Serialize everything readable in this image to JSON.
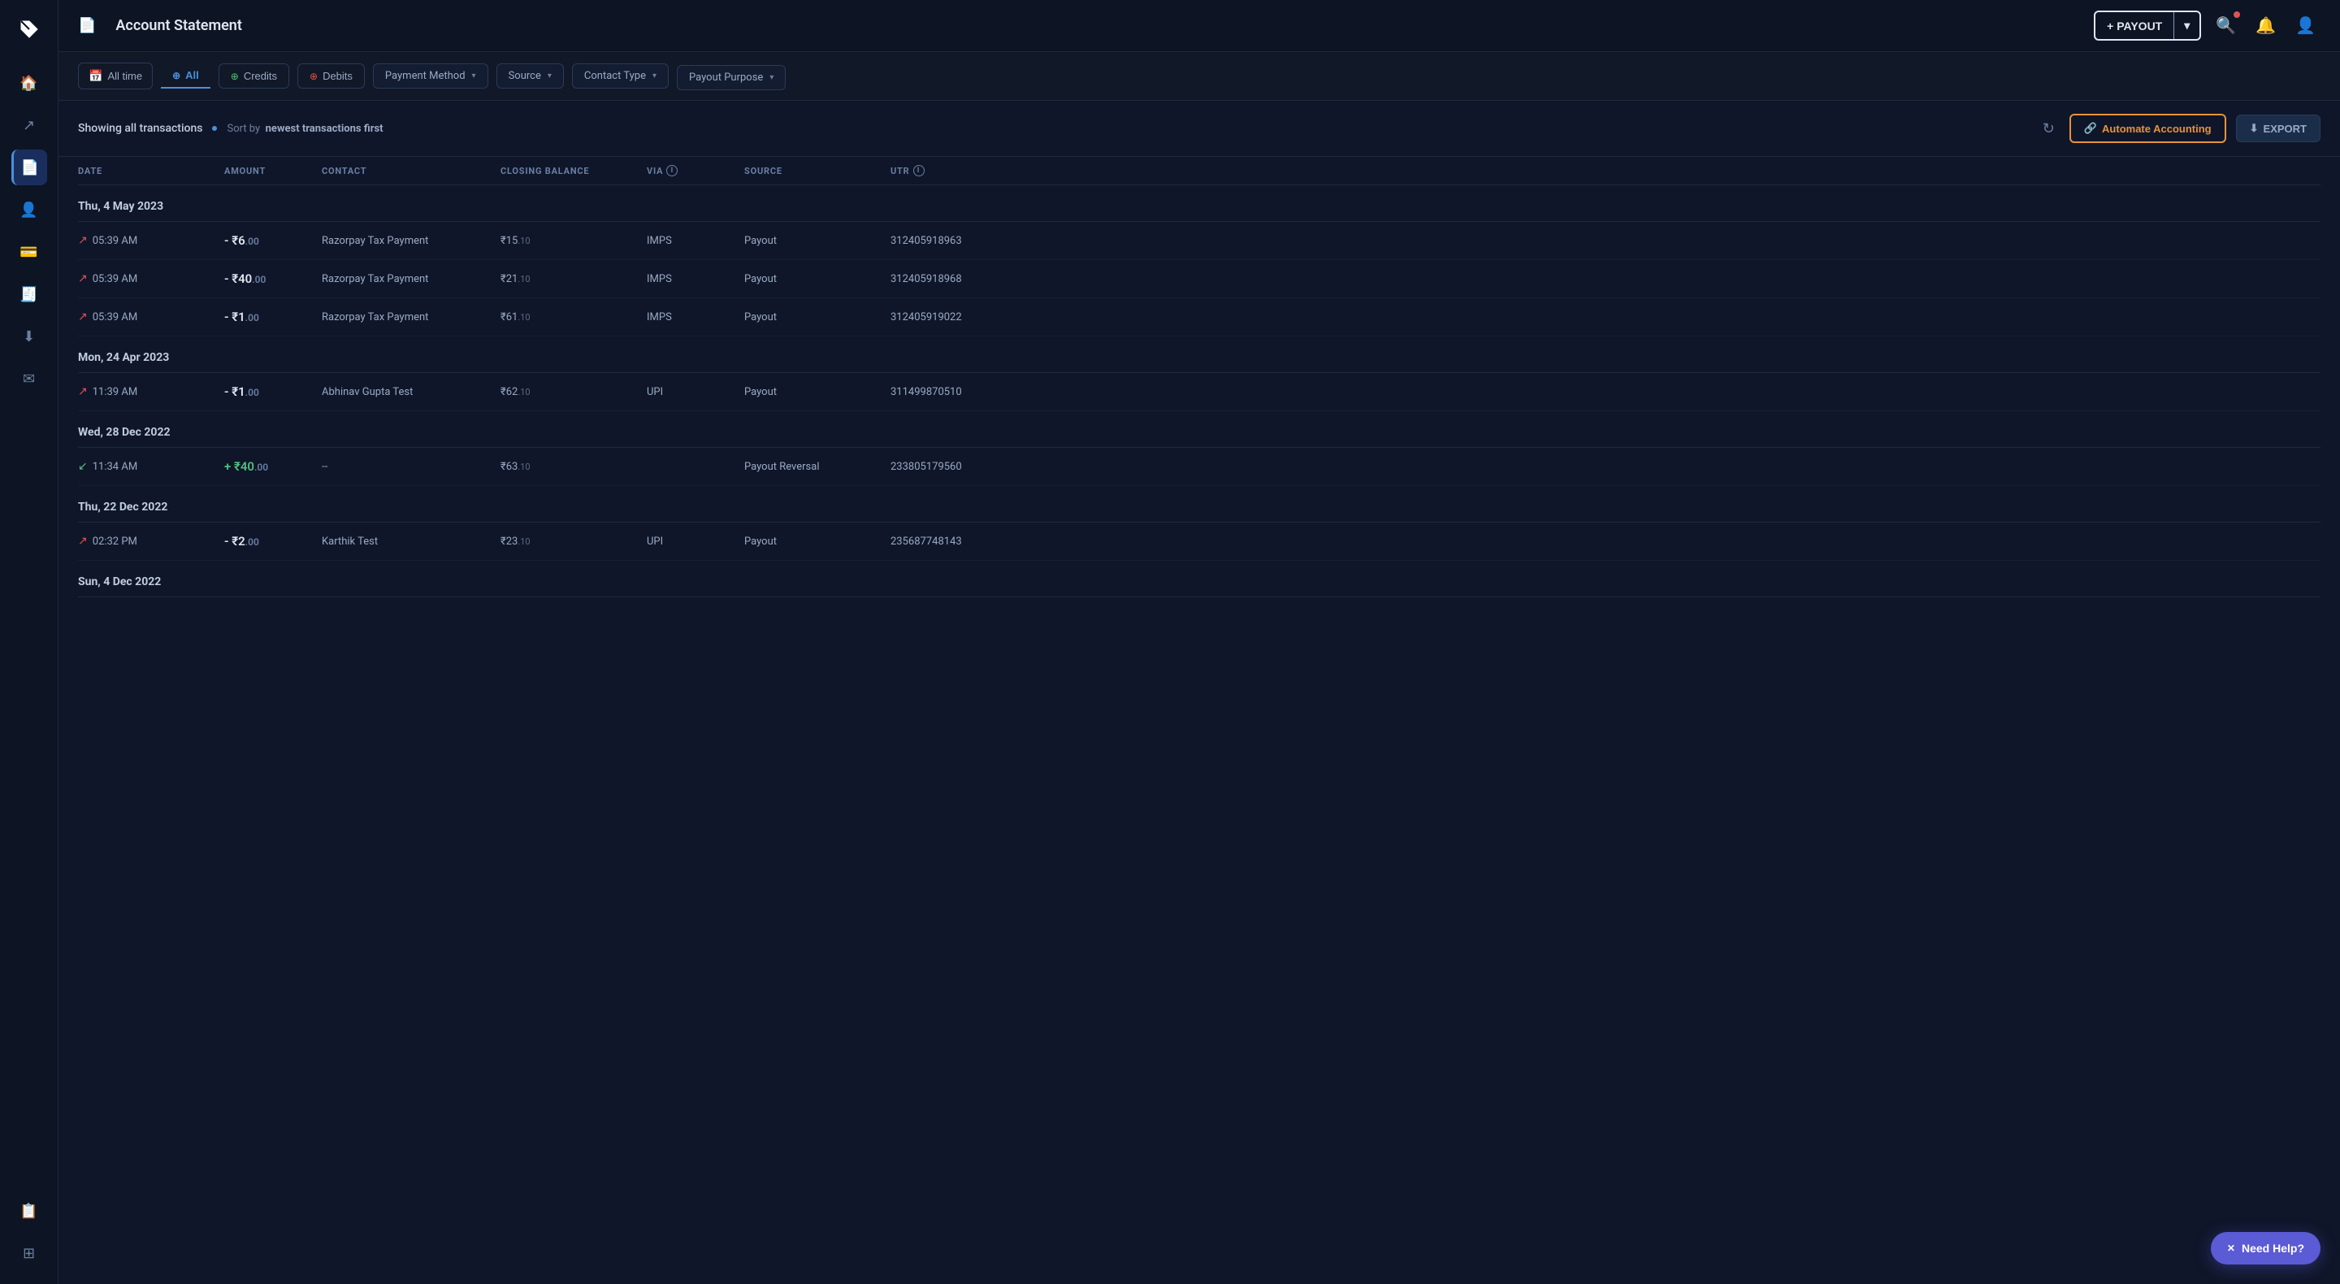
{
  "sidebar": {
    "items": [
      {
        "name": "home",
        "icon": "🏠",
        "active": false
      },
      {
        "name": "arrow-up-right",
        "icon": "↗",
        "active": false
      },
      {
        "name": "document",
        "icon": "📄",
        "active": true
      },
      {
        "name": "person",
        "icon": "👤",
        "active": false
      },
      {
        "name": "card",
        "icon": "💳",
        "active": false
      },
      {
        "name": "receipt",
        "icon": "🧾",
        "active": false
      },
      {
        "name": "download",
        "icon": "⬇",
        "active": false
      },
      {
        "name": "send",
        "icon": "✉",
        "active": false
      },
      {
        "name": "clipboard",
        "icon": "📋",
        "active": false
      },
      {
        "name": "grid",
        "icon": "⊞",
        "active": false
      }
    ]
  },
  "topbar": {
    "title": "Account Statement",
    "payout_button": "+ PAYOUT",
    "payout_arrow": "▾"
  },
  "filters": {
    "date_label": "All time",
    "all_label": "All",
    "credits_label": "Credits",
    "debits_label": "Debits",
    "payment_method_label": "Payment Method",
    "source_label": "Source",
    "contact_type_label": "Contact Type",
    "payout_purpose_label": "Payout Purpose"
  },
  "transaction_header": {
    "showing_label": "Showing all transactions",
    "sort_prefix": "Sort by",
    "sort_value": "newest transactions first",
    "automate_label": "Automate Accounting",
    "export_label": "EXPORT"
  },
  "column_headers": {
    "date": "DATE",
    "amount": "AMOUNT",
    "contact": "CONTACT",
    "closing_balance": "CLOSING BALANCE",
    "via": "VIA",
    "source": "SOURCE",
    "utr": "UTR"
  },
  "date_groups": [
    {
      "date": "Thu, 4 May 2023",
      "transactions": [
        {
          "time": "05:39 AM",
          "type": "debit",
          "amount": "- ₹6",
          "amount_decimal": ".00",
          "contact": "Razorpay Tax Payment",
          "closing_balance": "₹15",
          "balance_decimal": ".10",
          "via": "IMPS",
          "source": "Payout",
          "utr": "312405918963"
        },
        {
          "time": "05:39 AM",
          "type": "debit",
          "amount": "- ₹40",
          "amount_decimal": ".00",
          "contact": "Razorpay Tax Payment",
          "closing_balance": "₹21",
          "balance_decimal": ".10",
          "via": "IMPS",
          "source": "Payout",
          "utr": "312405918968"
        },
        {
          "time": "05:39 AM",
          "type": "debit",
          "amount": "- ₹1",
          "amount_decimal": ".00",
          "contact": "Razorpay Tax Payment",
          "closing_balance": "₹61",
          "balance_decimal": ".10",
          "via": "IMPS",
          "source": "Payout",
          "utr": "312405919022"
        }
      ]
    },
    {
      "date": "Mon, 24 Apr 2023",
      "transactions": [
        {
          "time": "11:39 AM",
          "type": "debit",
          "amount": "- ₹1",
          "amount_decimal": ".00",
          "contact": "Abhinav Gupta Test",
          "closing_balance": "₹62",
          "balance_decimal": ".10",
          "via": "UPI",
          "source": "Payout",
          "utr": "311499870510"
        }
      ]
    },
    {
      "date": "Wed, 28 Dec 2022",
      "transactions": [
        {
          "time": "11:34 AM",
          "type": "credit",
          "amount": "+ ₹40",
          "amount_decimal": ".00",
          "contact": "--",
          "closing_balance": "₹63",
          "balance_decimal": ".10",
          "via": "",
          "source": "Payout Reversal",
          "utr": "233805179560"
        }
      ]
    },
    {
      "date": "Thu, 22 Dec 2022",
      "transactions": [
        {
          "time": "02:32 PM",
          "type": "debit",
          "amount": "- ₹2",
          "amount_decimal": ".00",
          "contact": "Karthik Test",
          "closing_balance": "₹23",
          "balance_decimal": ".10",
          "via": "UPI",
          "source": "Payout",
          "utr": "235687748143"
        }
      ]
    },
    {
      "date": "Sun, 4 Dec 2022",
      "transactions": []
    }
  ],
  "need_help": {
    "label": "Need Help?",
    "icon": "✕"
  }
}
